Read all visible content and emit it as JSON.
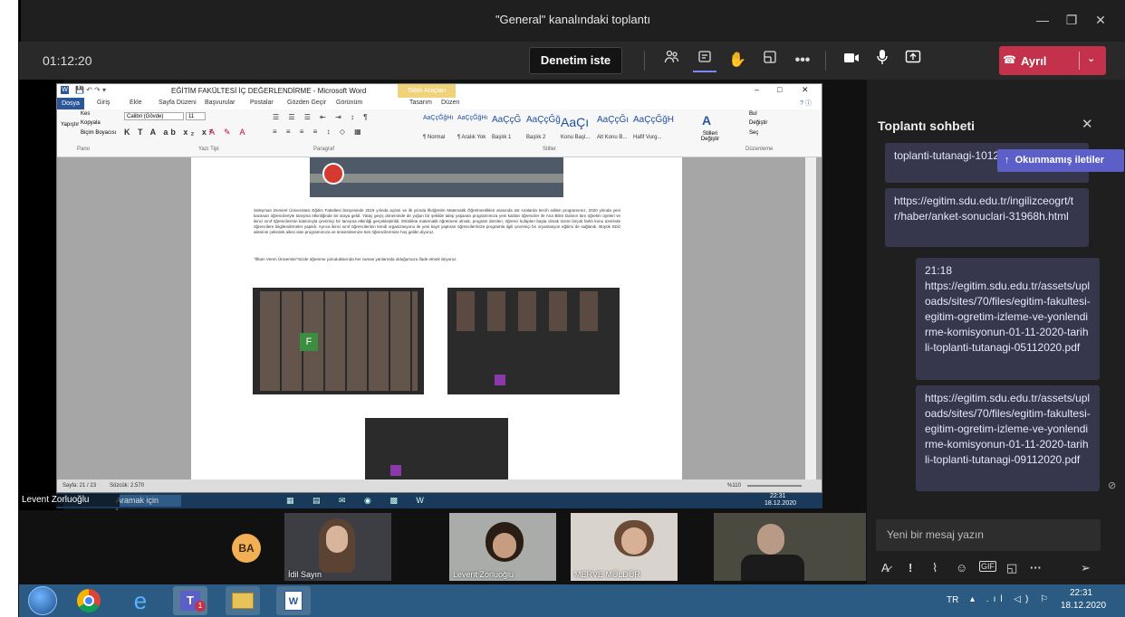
{
  "window": {
    "title": "\"General\" kanalındaki toplantı"
  },
  "toolbar": {
    "timer": "01:12:20",
    "ask_button": "Denetim iste",
    "leave_button": "Ayrıl"
  },
  "word": {
    "title": "EĞİTİM FAKÜLTESİ İÇ DEĞERLENDİRME - Microsoft Word",
    "table_tools": "Tablo Araçları",
    "tabs": [
      "Dosya",
      "Giriş",
      "Ekle",
      "Sayfa Düzeni",
      "Başvurular",
      "Postalar",
      "Gözden Geçir",
      "Görünüm",
      "Tasarım",
      "Düzen"
    ],
    "groups": {
      "clipboard": "Pano",
      "font": "Yazı Tipi",
      "paragraph": "Paragraf",
      "styles": "Stiller",
      "editing": "Düzenleme"
    },
    "clipboard_items": [
      "Kes",
      "Kopyala",
      "Biçim Boyacısı"
    ],
    "paste": "Yapıştır",
    "font_name": "Calibri (Gövde)",
    "font_size": "11",
    "styles": [
      {
        "sample": "AaÇçĞğHı",
        "name": "¶ Normal"
      },
      {
        "sample": "AaÇçĞğHı",
        "name": "¶ Aralık Yok"
      },
      {
        "sample": "AaÇçĞ",
        "name": "Başlık 1"
      },
      {
        "sample": "AaÇçĞğ",
        "name": "Başlık 2"
      },
      {
        "sample": "AaÇı",
        "name": "Konu Başl..."
      },
      {
        "sample": "AaÇçĞı",
        "name": "Alt Konu B..."
      },
      {
        "sample": "AaÇçĞğH",
        "name": "Hafif Vurg..."
      }
    ],
    "change_styles": "Stilleri Değiştir",
    "editing_items": [
      "Bul",
      "Değiştir",
      "Seç"
    ],
    "doc_text": "Süleyman Demirel Üniversitesi Eğitim Fakültesi bünyesinde 2019 yılında açılan ve ilk yılında İlköğretim Matematik Öğretmenlikleri arasında üst sıralarda tercih edilen programımız, 2020 yılında yeni kazanan öğrencileriyle tanışma etkinliğinde bir araya geldi. Yatay geçiş döneminde de yoğun bir şekilde talep yaşanan programımıza yeni katılan öğrenciler ile Ana Bilim Dalının tüm öğretim üyeleri ve ikinci sınıf öğrencilerinin katılımıyla çevrimiçi bir tanışma etkinliği gerçekleştirildi. Etkinlikte matematik öğretmeni olmak, program dersleri, öğrenci kulüpleri başta olmak üzere birçok farklı konu üzerinde öğrencilere bilgilendirmeler yapıldı. Ayrıca ikinci sınıf öğrencilerinin kendi organizasyonu ile yeni kayıt yaptıran öğrencilerimize programla ilgili çevrimiçi bir oryantasyon eğitimi de sağlandı. Büyük SDÜ ailesinin çekirdek ailesi olan programımıza ve üniversitemize tüm öğrencilerimize hoş geldin diyoruz.",
    "doc_quote": "\"İlham Veren Üniversite\"mizde öğrenme yolculuklarında her zaman yanlarında olduğumuzu ifade etmek istiyoruz.",
    "status_page": "Sayfa: 21 / 23",
    "status_words": "Sözcük: 2.570",
    "zoom": "%110"
  },
  "inner_taskbar": {
    "user": "Levent Zorluoğlu",
    "search": "Aramak için buraya yazın",
    "time": "22:31",
    "date": "18.12.2020"
  },
  "participants": [
    {
      "name": "İdil Sayın"
    },
    {
      "name": "Levent Zorluoğlu"
    },
    {
      "name": "MERVE MÜLDÜR"
    }
  ],
  "avatar_initials": "BA",
  "chat": {
    "title": "Toplantı sohbeti",
    "unread": "Okunmamış iletiler",
    "messages": [
      {
        "time": "",
        "text": "toplanti-tutanagi-10122020.pdf"
      },
      {
        "time": "",
        "text": "https://egitim.sdu.edu.tr/ingilizceogrt/tr/haber/anket-sonuclari-31968h.html"
      },
      {
        "time": "21:18",
        "text": "https://egitim.sdu.edu.tr/assets/uploads/sites/70/files/egitim-fakultesi-egitim-ogretim-izleme-ve-yonlendirme-komisyonun-01-11-2020-tarihli-toplanti-tutanagi-05112020.pdf"
      },
      {
        "time": "",
        "text": "https://egitim.sdu.edu.tr/assets/uploads/sites/70/files/egitim-fakultesi-egitim-ogretim-izleme-ve-yonlendirme-komisyonun-01-11-2020-tarihli-toplanti-tutanagi-09112020.pdf"
      }
    ],
    "compose_placeholder": "Yeni bir mesaj yazın"
  },
  "windows_taskbar": {
    "lang": "TR",
    "time": "22:31",
    "date": "18.12.2020"
  },
  "colors": {
    "leave": "#c4314b",
    "accent": "#5b5fc7",
    "chat_bubble": "#36374d",
    "avatar": "#f1b054"
  }
}
